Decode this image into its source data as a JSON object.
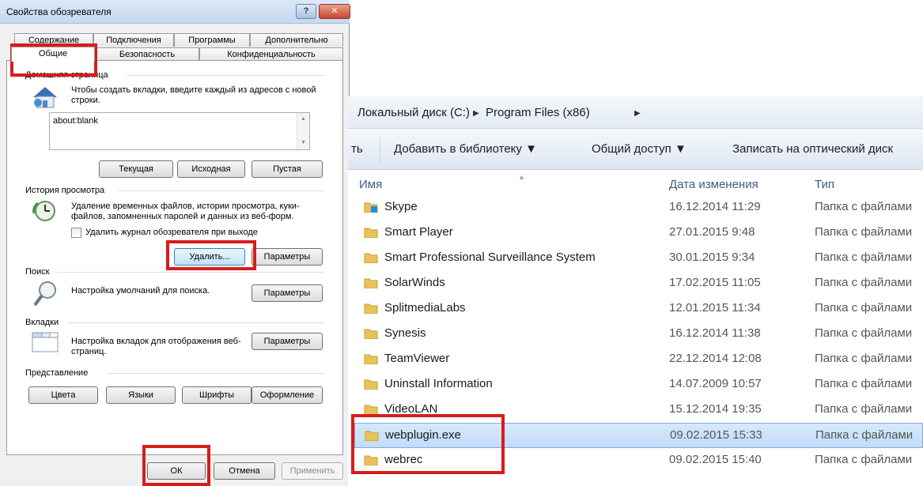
{
  "dialog": {
    "title": "Свойства обозревателя",
    "help_glyph": "?",
    "close_glyph": "✕",
    "tabs_row1": [
      "Содержание",
      "Подключения",
      "Программы",
      "Дополнительно"
    ],
    "tabs_row2": [
      "Общие",
      "Безопасность",
      "Конфиденциальность"
    ],
    "home": {
      "label": "Домашняя страница",
      "desc": "Чтобы создать вкладки, введите каждый из адресов с новой строки.",
      "value": "about:blank",
      "buttons": [
        "Текущая",
        "Исходная",
        "Пустая"
      ]
    },
    "history": {
      "label": "История просмотра",
      "desc": "Удаление временных файлов, истории просмотра, куки-файлов, запомненных паролей и данных из веб-форм.",
      "checkbox_label": "Удалить журнал обозревателя при выходе",
      "delete_button": "Удалить...",
      "params_button": "Параметры"
    },
    "search": {
      "label": "Поиск",
      "desc": "Настройка умолчаний для поиска.",
      "params_button": "Параметры"
    },
    "tabs_group": {
      "label": "Вкладки",
      "desc": "Настройка вкладок для отображения веб-страниц.",
      "params_button": "Параметры"
    },
    "appearance": {
      "label": "Представление",
      "buttons": [
        "Цвета",
        "Языки",
        "Шрифты",
        "Оформление"
      ]
    },
    "footer": {
      "ok": "ОК",
      "cancel": "Отмена",
      "apply": "Применить"
    }
  },
  "explorer": {
    "breadcrumb": [
      "Локальный диск (C:)",
      "Program Files (x86)"
    ],
    "breadcrumb_sep": "▶",
    "toolbar": {
      "partial": "ть",
      "add_library": "Добавить в библиотеку ▼",
      "share": "Общий доступ ▼",
      "burn": "Записать на оптический диск"
    },
    "columns": {
      "name": "Имя",
      "date": "Дата изменения",
      "type": "Тип"
    },
    "rows": [
      {
        "name": "Skype",
        "date": "16.12.2014 11:29",
        "type": "Папка с файлами"
      },
      {
        "name": "Smart Player",
        "date": "27.01.2015 9:48",
        "type": "Папка с файлами"
      },
      {
        "name": "Smart Professional Surveillance System",
        "date": "30.01.2015 9:34",
        "type": "Папка с файлами"
      },
      {
        "name": "SolarWinds",
        "date": "17.02.2015 11:05",
        "type": "Папка с файлами"
      },
      {
        "name": "SplitmediaLabs",
        "date": "12.01.2015 11:34",
        "type": "Папка с файлами"
      },
      {
        "name": "Synesis",
        "date": "16.12.2014 11:38",
        "type": "Папка с файлами"
      },
      {
        "name": "TeamViewer",
        "date": "22.12.2014 12:08",
        "type": "Папка с файлами"
      },
      {
        "name": "Uninstall Information",
        "date": "14.07.2009 10:57",
        "type": "Папка с файлами"
      },
      {
        "name": "VideoLAN",
        "date": "15.12.2014 19:35",
        "type": "Папка с файлами"
      },
      {
        "name": "webplugin.exe",
        "date": "09.02.2015 15:33",
        "type": "Папка с файлами"
      },
      {
        "name": "webrec",
        "date": "09.02.2015 15:40",
        "type": "Папка с файлами"
      }
    ],
    "folder_color": "#e8c35a",
    "selection_color": "#c1dcf8"
  },
  "annotation_color": "#d91b1b"
}
